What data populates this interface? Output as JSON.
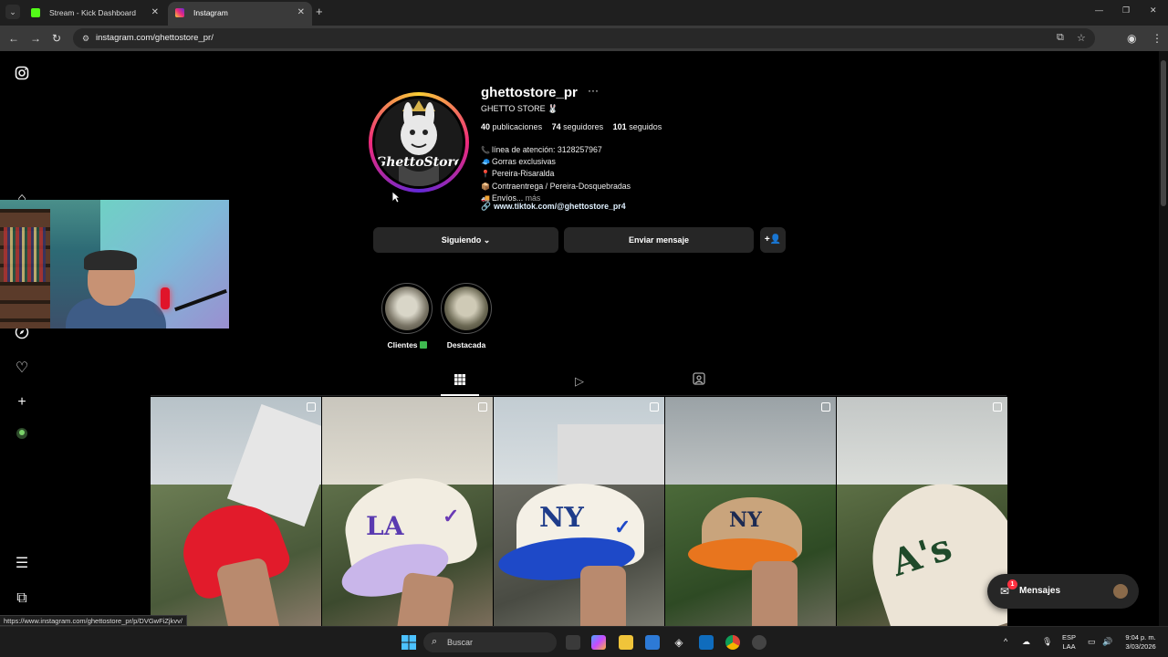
{
  "browser": {
    "tabs": [
      {
        "title": "Stream - Kick Dashboard",
        "favicon_color": "#53fc18"
      },
      {
        "title": "Instagram",
        "favicon_color": "#e1306c"
      }
    ],
    "url": "instagram.com/ghettostore_pr/",
    "status_url": "https://www.instagram.com/ghettostore_pr/p/DVGwFiZjkvv/"
  },
  "profile": {
    "username": "ghettostore_pr",
    "full_name": "GHETTO STORE 🐰",
    "avatar_text": "GhettoStore",
    "stats": {
      "posts_count": "40",
      "posts_label": "publicaciones",
      "followers_count": "74",
      "followers_label": "seguidores",
      "following_count": "101",
      "following_label": "seguidos"
    },
    "bio": [
      {
        "icon": "📞",
        "text": "línea de atención: 3128257967"
      },
      {
        "icon": "🧢",
        "text": "Gorras exclusivas"
      },
      {
        "icon": "📍",
        "text": "Pereira-Risaralda"
      },
      {
        "icon": "📦",
        "text": "Contraentrega / Pereira-Dosquebradas"
      },
      {
        "icon": "🚚",
        "text": "Envíos..."
      }
    ],
    "bio_more": "más",
    "link": "www.tiktok.com/@ghettostore_pr4",
    "buttons": {
      "following": "Siguiendo",
      "message": "Enviar mensaje"
    },
    "highlights": [
      {
        "label": "Clientes"
      },
      {
        "label": "Destacada"
      }
    ]
  },
  "messages": {
    "label": "Mensajes",
    "badge": "1"
  },
  "taskbar": {
    "search_placeholder": "Buscar",
    "lang_top": "ESP",
    "lang_bottom": "LAA",
    "time": "9:04 p. m.",
    "date": "3/03/2026"
  },
  "colors": {
    "accent_link": "#e0f1ff",
    "button_bg": "#262626",
    "badge": "#ff3040"
  }
}
